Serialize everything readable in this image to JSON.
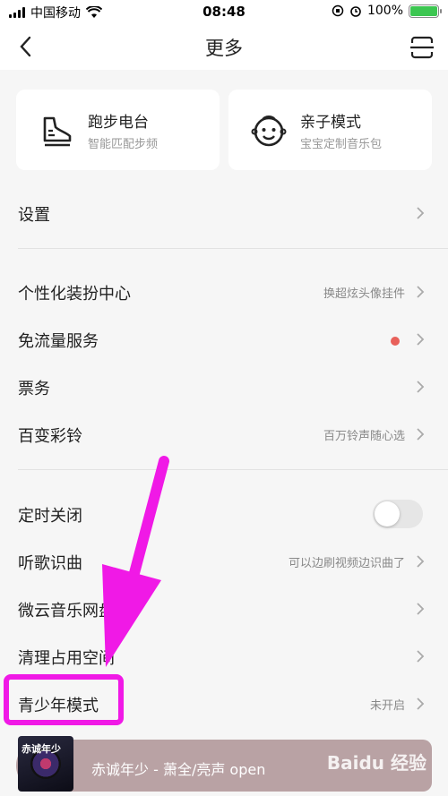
{
  "status_bar": {
    "carrier": "中国移动",
    "time": "08:48",
    "battery": "100%"
  },
  "nav": {
    "title": "更多"
  },
  "cards": [
    {
      "title": "跑步电台",
      "subtitle": "智能匹配步频",
      "icon": "running-shoe-icon"
    },
    {
      "title": "亲子模式",
      "subtitle": "宝宝定制音乐包",
      "icon": "baby-face-icon"
    }
  ],
  "menu": {
    "settings": {
      "label": "设置"
    },
    "decor": {
      "label": "个性化装扮中心",
      "hint": "换超炫头像挂件"
    },
    "data_free": {
      "label": "免流量服务"
    },
    "tickets": {
      "label": "票务"
    },
    "ringtone": {
      "label": "百变彩铃",
      "hint": "百万铃声随心选"
    },
    "timer": {
      "label": "定时关闭",
      "toggle_on": false
    },
    "recognize": {
      "label": "听歌识曲",
      "hint": "可以边刷视频边识曲了"
    },
    "weiyun": {
      "label": "微云音乐网盘"
    },
    "cleanup": {
      "label": "清理占用空间"
    },
    "youth": {
      "label": "青少年模式",
      "hint": "未开启"
    }
  },
  "player": {
    "song": "赤诚年少 - 萧全/亮声 open",
    "cover_text": "赤诚年少"
  },
  "watermark": "Baidu 经验",
  "colors": {
    "annotation": "#f019e6",
    "red_dot": "#e8605a",
    "battery": "#3cc651"
  }
}
